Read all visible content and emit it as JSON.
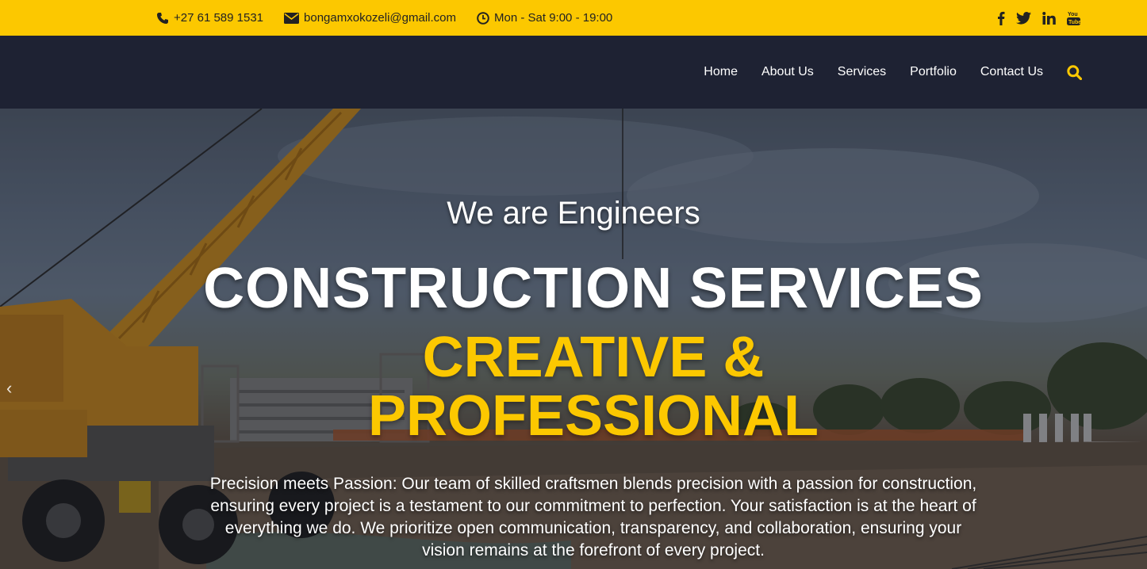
{
  "topbar": {
    "phone": "+27 61 589 1531",
    "email": "bongamxokozeli@gmail.com",
    "hours": "Mon - Sat 9:00 - 19:00",
    "social": [
      "facebook-icon",
      "twitter-icon",
      "linkedin-icon",
      "youtube-icon"
    ],
    "background": "#fcc800"
  },
  "nav": {
    "items": [
      "Home",
      "About Us",
      "Services",
      "Portfolio",
      "Contact Us"
    ],
    "search_icon": "search-icon",
    "background": "#1e2233",
    "accent": "#fcc800"
  },
  "hero": {
    "tagline": "We are Engineers",
    "headline": "CONSTRUCTION SERVICES",
    "subheadline_line1": "CREATIVE &",
    "subheadline_line2": "PROFESSIONAL",
    "description": "Precision meets Passion: Our team of skilled craftsmen blends precision with a passion for construction, ensuring every project is a testament to our commitment to perfection. Your satisfaction is at the heart of everything we do. We prioritize open communication, transparency, and collaboration, ensuring your vision remains at the forefront of every project.",
    "prev_arrow": "‹"
  }
}
